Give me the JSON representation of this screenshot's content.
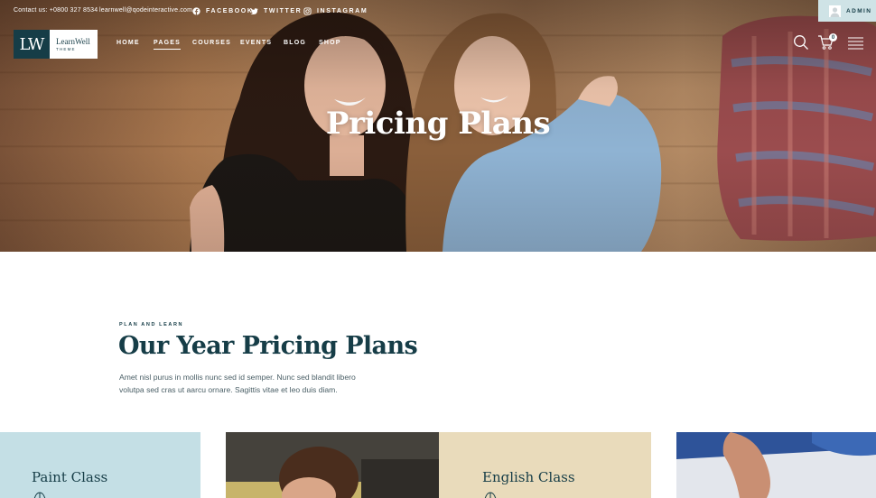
{
  "topbar": {
    "contact": "Contact us: +0800 327 8534",
    "email": "learnwell@qodeinteractive.com",
    "social": [
      {
        "label": "FACEBOOK",
        "icon": "facebook-icon"
      },
      {
        "label": "TWITTER",
        "icon": "twitter-icon"
      },
      {
        "label": "INSTAGRAM",
        "icon": "instagram-icon"
      }
    ],
    "admin_label": "ADMIN"
  },
  "logo": {
    "mark": "LW",
    "name": "LearnWell",
    "tagline": "THEME"
  },
  "nav": {
    "items": [
      "HOME",
      "PAGES",
      "COURSES",
      "EVENTS",
      "BLOG",
      "SHOP"
    ],
    "active": "PAGES"
  },
  "header": {
    "cart_count": "0"
  },
  "hero": {
    "title": "Pricing Plans"
  },
  "intro": {
    "eyebrow": "PLAN AND LEARN",
    "title": "Our Year Pricing Plans",
    "text": "Amet nisl purus in mollis nunc sed id semper. Nunc sed blandit libero volutpa sed cras ut aarcu ornare. Sagittis vitae et leo duis diam."
  },
  "cards": [
    {
      "label": "Paint Class"
    },
    {
      "label": "English Class"
    }
  ],
  "colors": {
    "primary": "#163d47",
    "card_blue": "#c4dfe5",
    "card_beige": "#e9dbbb",
    "admin_bg": "#cfe3e6"
  }
}
